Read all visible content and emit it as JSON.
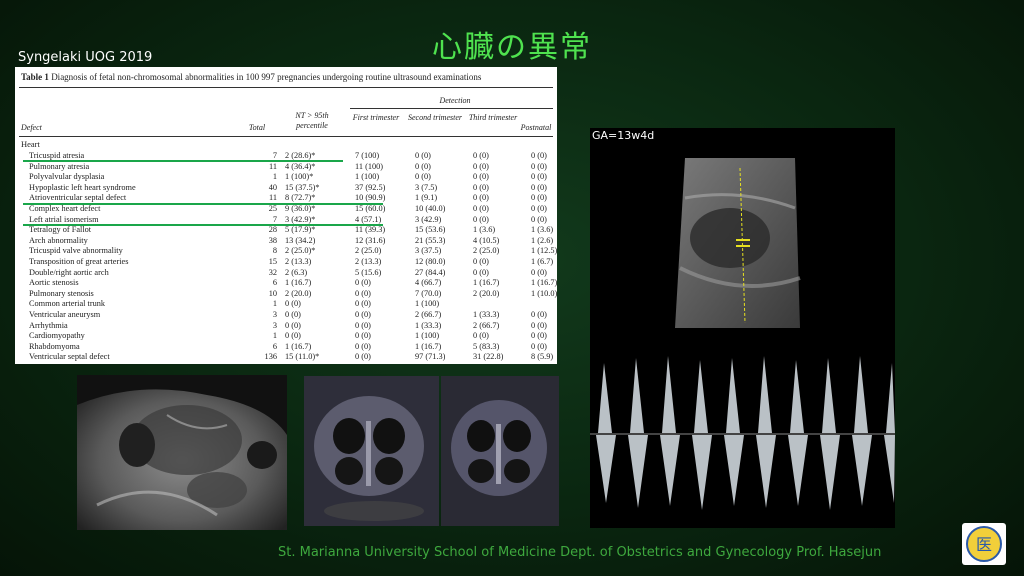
{
  "slide": {
    "title": "心臓の異常",
    "source": "Syngelaki UOG 2019",
    "footer": "St. Marianna University School of Medicine Dept. of Obstetrics and Gynecology Prof. Hasejun",
    "ga_label": "GA=13w4d",
    "logo_text": "医"
  },
  "table": {
    "caption_bold": "Table 1",
    "caption": "Diagnosis of fetal non-chromosomal abnormalities in 100 997 pregnancies undergoing routine ultrasound examinations",
    "group_header": "Detection",
    "headers": {
      "defect": "Defect",
      "total": "Total",
      "nt": "NT > 95th percentile",
      "first": "First trimester",
      "second": "Second trimester",
      "third": "Third trimester",
      "postnatal": "Postnatal"
    },
    "section": "Heart",
    "rows": [
      [
        "Tricuspid atresia",
        "7",
        "2 (28.6)*",
        "7 (100)",
        "0 (0)",
        "0 (0)",
        "0 (0)"
      ],
      [
        "Pulmonary atresia",
        "11",
        "4 (36.4)*",
        "11 (100)",
        "0 (0)",
        "0 (0)",
        "0 (0)"
      ],
      [
        "Polyvalvular dysplasia",
        "1",
        "1 (100)*",
        "1 (100)",
        "0 (0)",
        "0 (0)",
        "0 (0)"
      ],
      [
        "Hypoplastic left heart syndrome",
        "40",
        "15 (37.5)*",
        "37 (92.5)",
        "3 (7.5)",
        "0 (0)",
        "0 (0)"
      ],
      [
        "Atrioventricular septal defect",
        "11",
        "8 (72.7)*",
        "10 (90.9)",
        "1 (9.1)",
        "0 (0)",
        "0 (0)"
      ],
      [
        "Complex heart defect",
        "25",
        "9 (36.0)*",
        "15 (60.0)",
        "10 (40.0)",
        "0 (0)",
        "0 (0)"
      ],
      [
        "Left atrial isomerism",
        "7",
        "3 (42.9)*",
        "4 (57.1)",
        "3 (42.9)",
        "0 (0)",
        "0 (0)"
      ],
      [
        "Tetralogy of Fallot",
        "28",
        "5 (17.9)*",
        "11 (39.3)",
        "15 (53.6)",
        "1 (3.6)",
        "1 (3.6)"
      ],
      [
        "Arch abnormality",
        "38",
        "13 (34.2)",
        "12 (31.6)",
        "21 (55.3)",
        "4 (10.5)",
        "1 (2.6)"
      ],
      [
        "Tricuspid valve abnormality",
        "8",
        "2 (25.0)*",
        "2 (25.0)",
        "3 (37.5)",
        "2 (25.0)",
        "1 (12.5)"
      ],
      [
        "Transposition of great arteries",
        "15",
        "2 (13.3)",
        "2 (13.3)",
        "12 (80.0)",
        "0 (0)",
        "1 (6.7)"
      ],
      [
        "Double/right aortic arch",
        "32",
        "2 (6.3)",
        "5 (15.6)",
        "27 (84.4)",
        "0 (0)",
        "0 (0)"
      ],
      [
        "Aortic stenosis",
        "6",
        "1 (16.7)",
        "0 (0)",
        "4 (66.7)",
        "1 (16.7)",
        "1 (16.7)"
      ],
      [
        "Pulmonary stenosis",
        "10",
        "2 (20.0)",
        "0 (0)",
        "7 (70.0)",
        "2 (20.0)",
        "1 (10.0)"
      ],
      [
        "Common arterial trunk",
        "1",
        "0 (0)",
        "0 (0)",
        "1 (100)",
        "",
        ""
      ],
      [
        "Ventricular aneurysm",
        "3",
        "0 (0)",
        "0 (0)",
        "2 (66.7)",
        "1 (33.3)",
        "0 (0)"
      ],
      [
        "Arrhythmia",
        "3",
        "0 (0)",
        "0 (0)",
        "1 (33.3)",
        "2 (66.7)",
        "0 (0)"
      ],
      [
        "Cardiomyopathy",
        "1",
        "0 (0)",
        "0 (0)",
        "1 (100)",
        "0 (0)",
        "0 (0)"
      ],
      [
        "Rhabdomyoma",
        "6",
        "1 (16.7)",
        "0 (0)",
        "1 (16.7)",
        "5 (83.3)",
        "0 (0)"
      ],
      [
        "Ventricular septal defect",
        "136",
        "15 (11.0)*",
        "0 (0)",
        "97 (71.3)",
        "31 (22.8)",
        "8 (5.9)"
      ]
    ]
  }
}
